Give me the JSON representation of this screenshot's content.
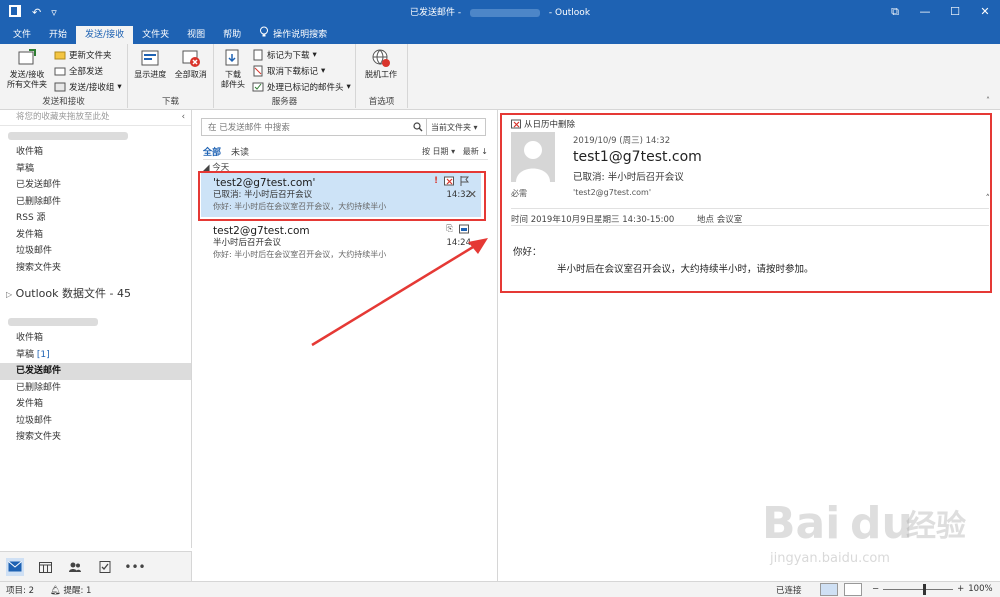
{
  "titlebar": {
    "title_left": "已发送邮件",
    "separator": "-",
    "app_name": "Outlook"
  },
  "tabs": [
    "文件",
    "开始",
    "发送/接收",
    "文件夹",
    "视图",
    "帮助"
  ],
  "tab_help": "操作说明搜索",
  "ribbon": {
    "group_send": {
      "label": "发送和接收",
      "big": "发送/接收\n所有文件夹",
      "small": [
        "更新文件夹",
        "全部发送",
        "发送/接收组"
      ]
    },
    "group_download": {
      "label": "下载",
      "b1": "显示进度",
      "b2": "全部取消"
    },
    "group_server": {
      "label": "服务器",
      "big": "下载\n邮件头",
      "small": [
        "标记为下载",
        "取消下载标记",
        "处理已标记的邮件头"
      ]
    },
    "group_prefs": {
      "label": "首选项",
      "big": "脱机工作"
    }
  },
  "folderpane": {
    "fav_hint": "将您的收藏夹拖放至此处",
    "account1_folders": [
      "收件箱",
      "草稿",
      "已发送邮件",
      "已删除邮件",
      "RSS 源",
      "发件箱",
      "垃圾邮件",
      "搜索文件夹"
    ],
    "data_file": "Outlook 数据文件 - 45",
    "account2_folders": [
      "收件箱",
      "草稿",
      "已发送邮件",
      "已删除邮件",
      "发件箱",
      "垃圾邮件",
      "搜索文件夹"
    ],
    "draft_count": "[1]"
  },
  "msglist": {
    "search_placeholder": "在 已发送邮件 中搜索",
    "scope": "当前文件夹",
    "filter_all": "全部",
    "filter_unread": "未读",
    "sort_by": "按 日期",
    "sort_order": "最新 ↓",
    "group_today": "今天",
    "messages": [
      {
        "from": "'test2@g7test.com'",
        "subject": "已取消: 半小时后召开会议",
        "preview": "你好:   半小时后在会议室召开会议，大约持续半小",
        "time": "14:32"
      },
      {
        "from": "test2@g7test.com",
        "subject": "半小时后召开会议",
        "preview": "你好:   半小时后在会议室召开会议，大约持续半小",
        "time": "14:24"
      }
    ]
  },
  "reading": {
    "remove_cal": "从日历中删除",
    "date": "2019/10/9 (周三) 14:32",
    "sender": "test1@g7test.com",
    "subject": "已取消: 半小时后召开会议",
    "required": "必需",
    "to": "'test2@g7test.com'",
    "time_line": "时间 2019年10月9日星期三 14:30-15:00",
    "location": "地点 会议室",
    "greeting": "你好：",
    "body": "半小时后在会议室召开会议，大约持续半小时，请按时参加。"
  },
  "status": {
    "items": "项目: 2",
    "reminders": "提醒: 1",
    "connection": "已连接",
    "zoom": "100%"
  },
  "watermark": {
    "brand": "Bai",
    "brand2": "du",
    "brand3": "经验",
    "url": "jingyan.baidu.com"
  },
  "colors": {
    "accent": "#1e62b3",
    "annotation": "#e53935",
    "selected_msg": "#cde3f7"
  }
}
